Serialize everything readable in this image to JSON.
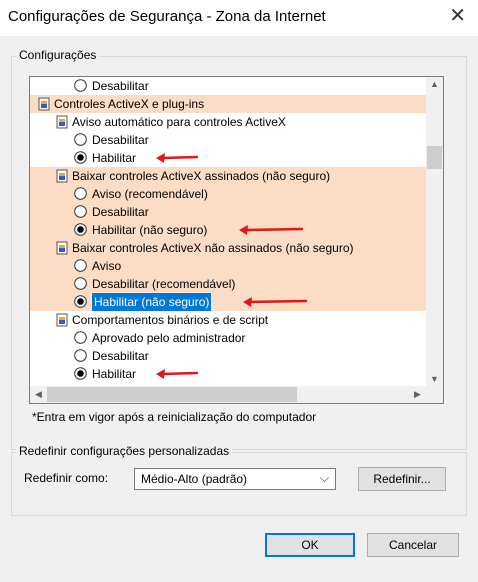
{
  "window": {
    "title": "Configurações de Segurança - Zona da Internet",
    "close_glyph": "✕"
  },
  "settings_group": {
    "label": "Configurações"
  },
  "list": {
    "rows": [
      {
        "kind": "radio",
        "label": "Desabilitar",
        "checked": false,
        "highlight": false,
        "indent": 2
      },
      {
        "kind": "category",
        "label": "Controles ActiveX e plug-ins",
        "highlight": true,
        "indent": 0
      },
      {
        "kind": "setting",
        "label": "Aviso automático para controles ActiveX",
        "highlight": false,
        "indent": 1
      },
      {
        "kind": "radio",
        "label": "Desabilitar",
        "checked": false,
        "highlight": false,
        "indent": 2
      },
      {
        "kind": "radio",
        "label": "Habilitar",
        "checked": true,
        "highlight": false,
        "indent": 2,
        "arrow": true
      },
      {
        "kind": "setting",
        "label": "Baixar controles ActiveX assinados (não seguro)",
        "highlight": true,
        "indent": 1
      },
      {
        "kind": "radio",
        "label": "Aviso (recomendável)",
        "checked": false,
        "highlight": true,
        "indent": 2
      },
      {
        "kind": "radio",
        "label": "Desabilitar",
        "checked": false,
        "highlight": true,
        "indent": 2
      },
      {
        "kind": "radio",
        "label": "Habilitar (não seguro)",
        "checked": true,
        "highlight": true,
        "indent": 2,
        "arrow": true
      },
      {
        "kind": "setting",
        "label": "Baixar controles ActiveX não assinados (não seguro)",
        "highlight": true,
        "indent": 1
      },
      {
        "kind": "radio",
        "label": "Aviso",
        "checked": false,
        "highlight": true,
        "indent": 2
      },
      {
        "kind": "radio",
        "label": "Desabilitar (recomendável)",
        "checked": false,
        "highlight": true,
        "indent": 2
      },
      {
        "kind": "radio",
        "label": "Habilitar (não seguro)",
        "checked": true,
        "highlight": true,
        "indent": 2,
        "arrow": true,
        "selected": true
      },
      {
        "kind": "setting",
        "label": "Comportamentos binários e de script",
        "highlight": false,
        "indent": 1
      },
      {
        "kind": "radio",
        "label": "Aprovado pelo administrador",
        "checked": false,
        "highlight": false,
        "indent": 2
      },
      {
        "kind": "radio",
        "label": "Desabilitar",
        "checked": false,
        "highlight": false,
        "indent": 2
      },
      {
        "kind": "radio",
        "label": "Habilitar",
        "checked": true,
        "highlight": false,
        "indent": 2,
        "arrow": true
      }
    ]
  },
  "note": "*Entra em vigor após a reinicialização do computador",
  "reset_group": {
    "label": "Redefinir configurações personalizadas",
    "reset_to_label": "Redefinir como:",
    "selected_level": "Médio-Alto (padrão)",
    "reset_button": "Redefinir..."
  },
  "buttons": {
    "ok": "OK",
    "cancel": "Cancelar"
  },
  "colors": {
    "highlight": "#fbdcc4",
    "arrow": "#e0161b",
    "selection": "#0078d7"
  }
}
